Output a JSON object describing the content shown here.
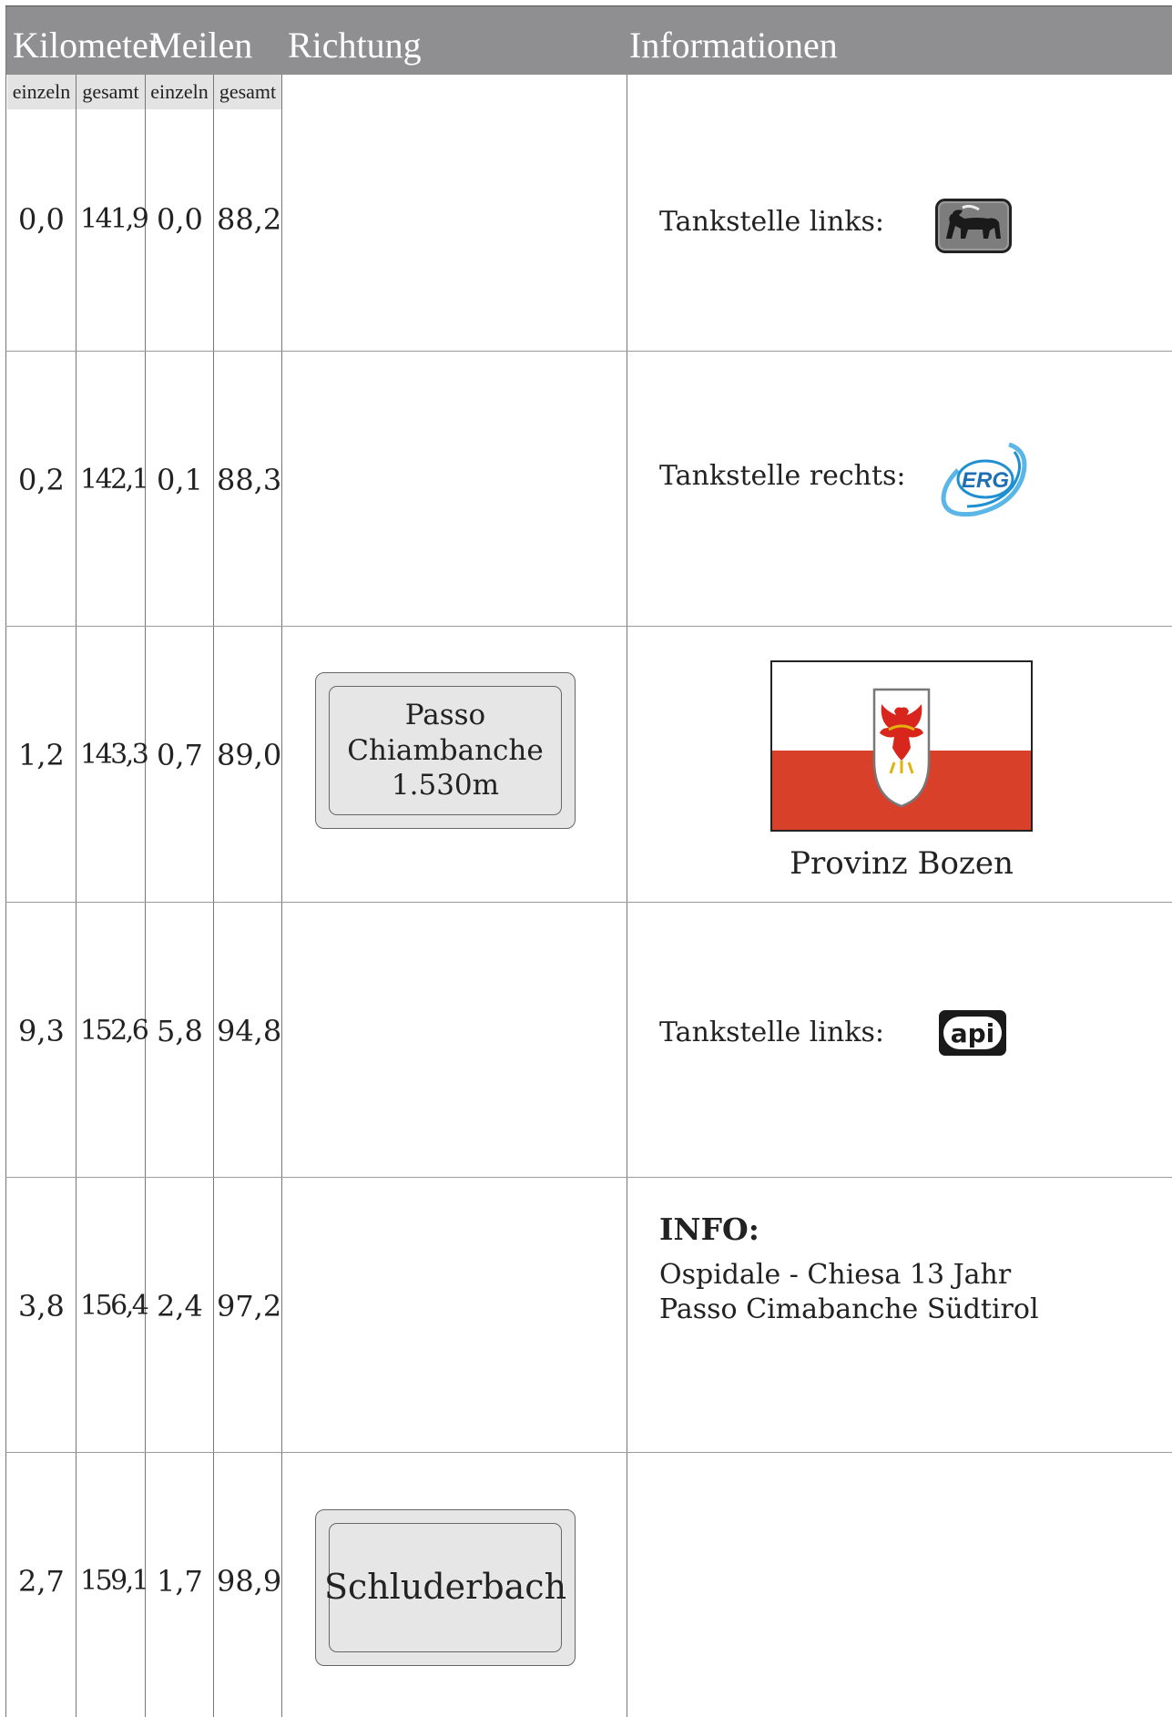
{
  "header": {
    "kilometer": "Kilometer",
    "meilen": "Meilen",
    "richtung": "Richtung",
    "informationen": "Informationen"
  },
  "subheader": [
    "einzeln",
    "gesamt",
    "einzeln",
    "gesamt"
  ],
  "rows": [
    {
      "km_einzeln": "0,0",
      "km_gesamt": "141,9",
      "mi_einzeln": "0,0",
      "mi_gesamt": "88,2",
      "info": "Tankstelle links:",
      "logo": "eni-dog-icon"
    },
    {
      "km_einzeln": "0,2",
      "km_gesamt": "142,1",
      "mi_einzeln": "0,1",
      "mi_gesamt": "88,3",
      "info": "Tankstelle rechts:",
      "logo": "erg-logo-icon"
    },
    {
      "km_einzeln": "1,2",
      "km_gesamt": "143,3",
      "mi_einzeln": "0,7",
      "mi_gesamt": "89,0",
      "sign": "Passo\nChiambanche\n1.530m",
      "flag_caption": "Provinz Bozen"
    },
    {
      "km_einzeln": "9,3",
      "km_gesamt": "152,6",
      "mi_einzeln": "5,8",
      "mi_gesamt": "94,8",
      "info": "Tankstelle links:",
      "logo": "api-logo-icon"
    },
    {
      "km_einzeln": "3,8",
      "km_gesamt": "156,4",
      "mi_einzeln": "2,4",
      "mi_gesamt": "97,2",
      "info_title": "INFO:",
      "info_line1": "Ospidale - Chiesa 13 Jahr",
      "info_line2": "Passo Cimabanche Südtirol"
    },
    {
      "km_einzeln": "2,7",
      "km_gesamt": "159,1",
      "mi_einzeln": "1,7",
      "mi_gesamt": "98,9",
      "sign": "Schluderbach"
    }
  ],
  "logos": {
    "erg_text": "ERG",
    "api_text": "api"
  },
  "colors": {
    "header_bg": "#8f8f91",
    "subheader_bg": "#e3e3e3",
    "flag_red": "#d9402a",
    "eagle_red": "#d8261c"
  }
}
